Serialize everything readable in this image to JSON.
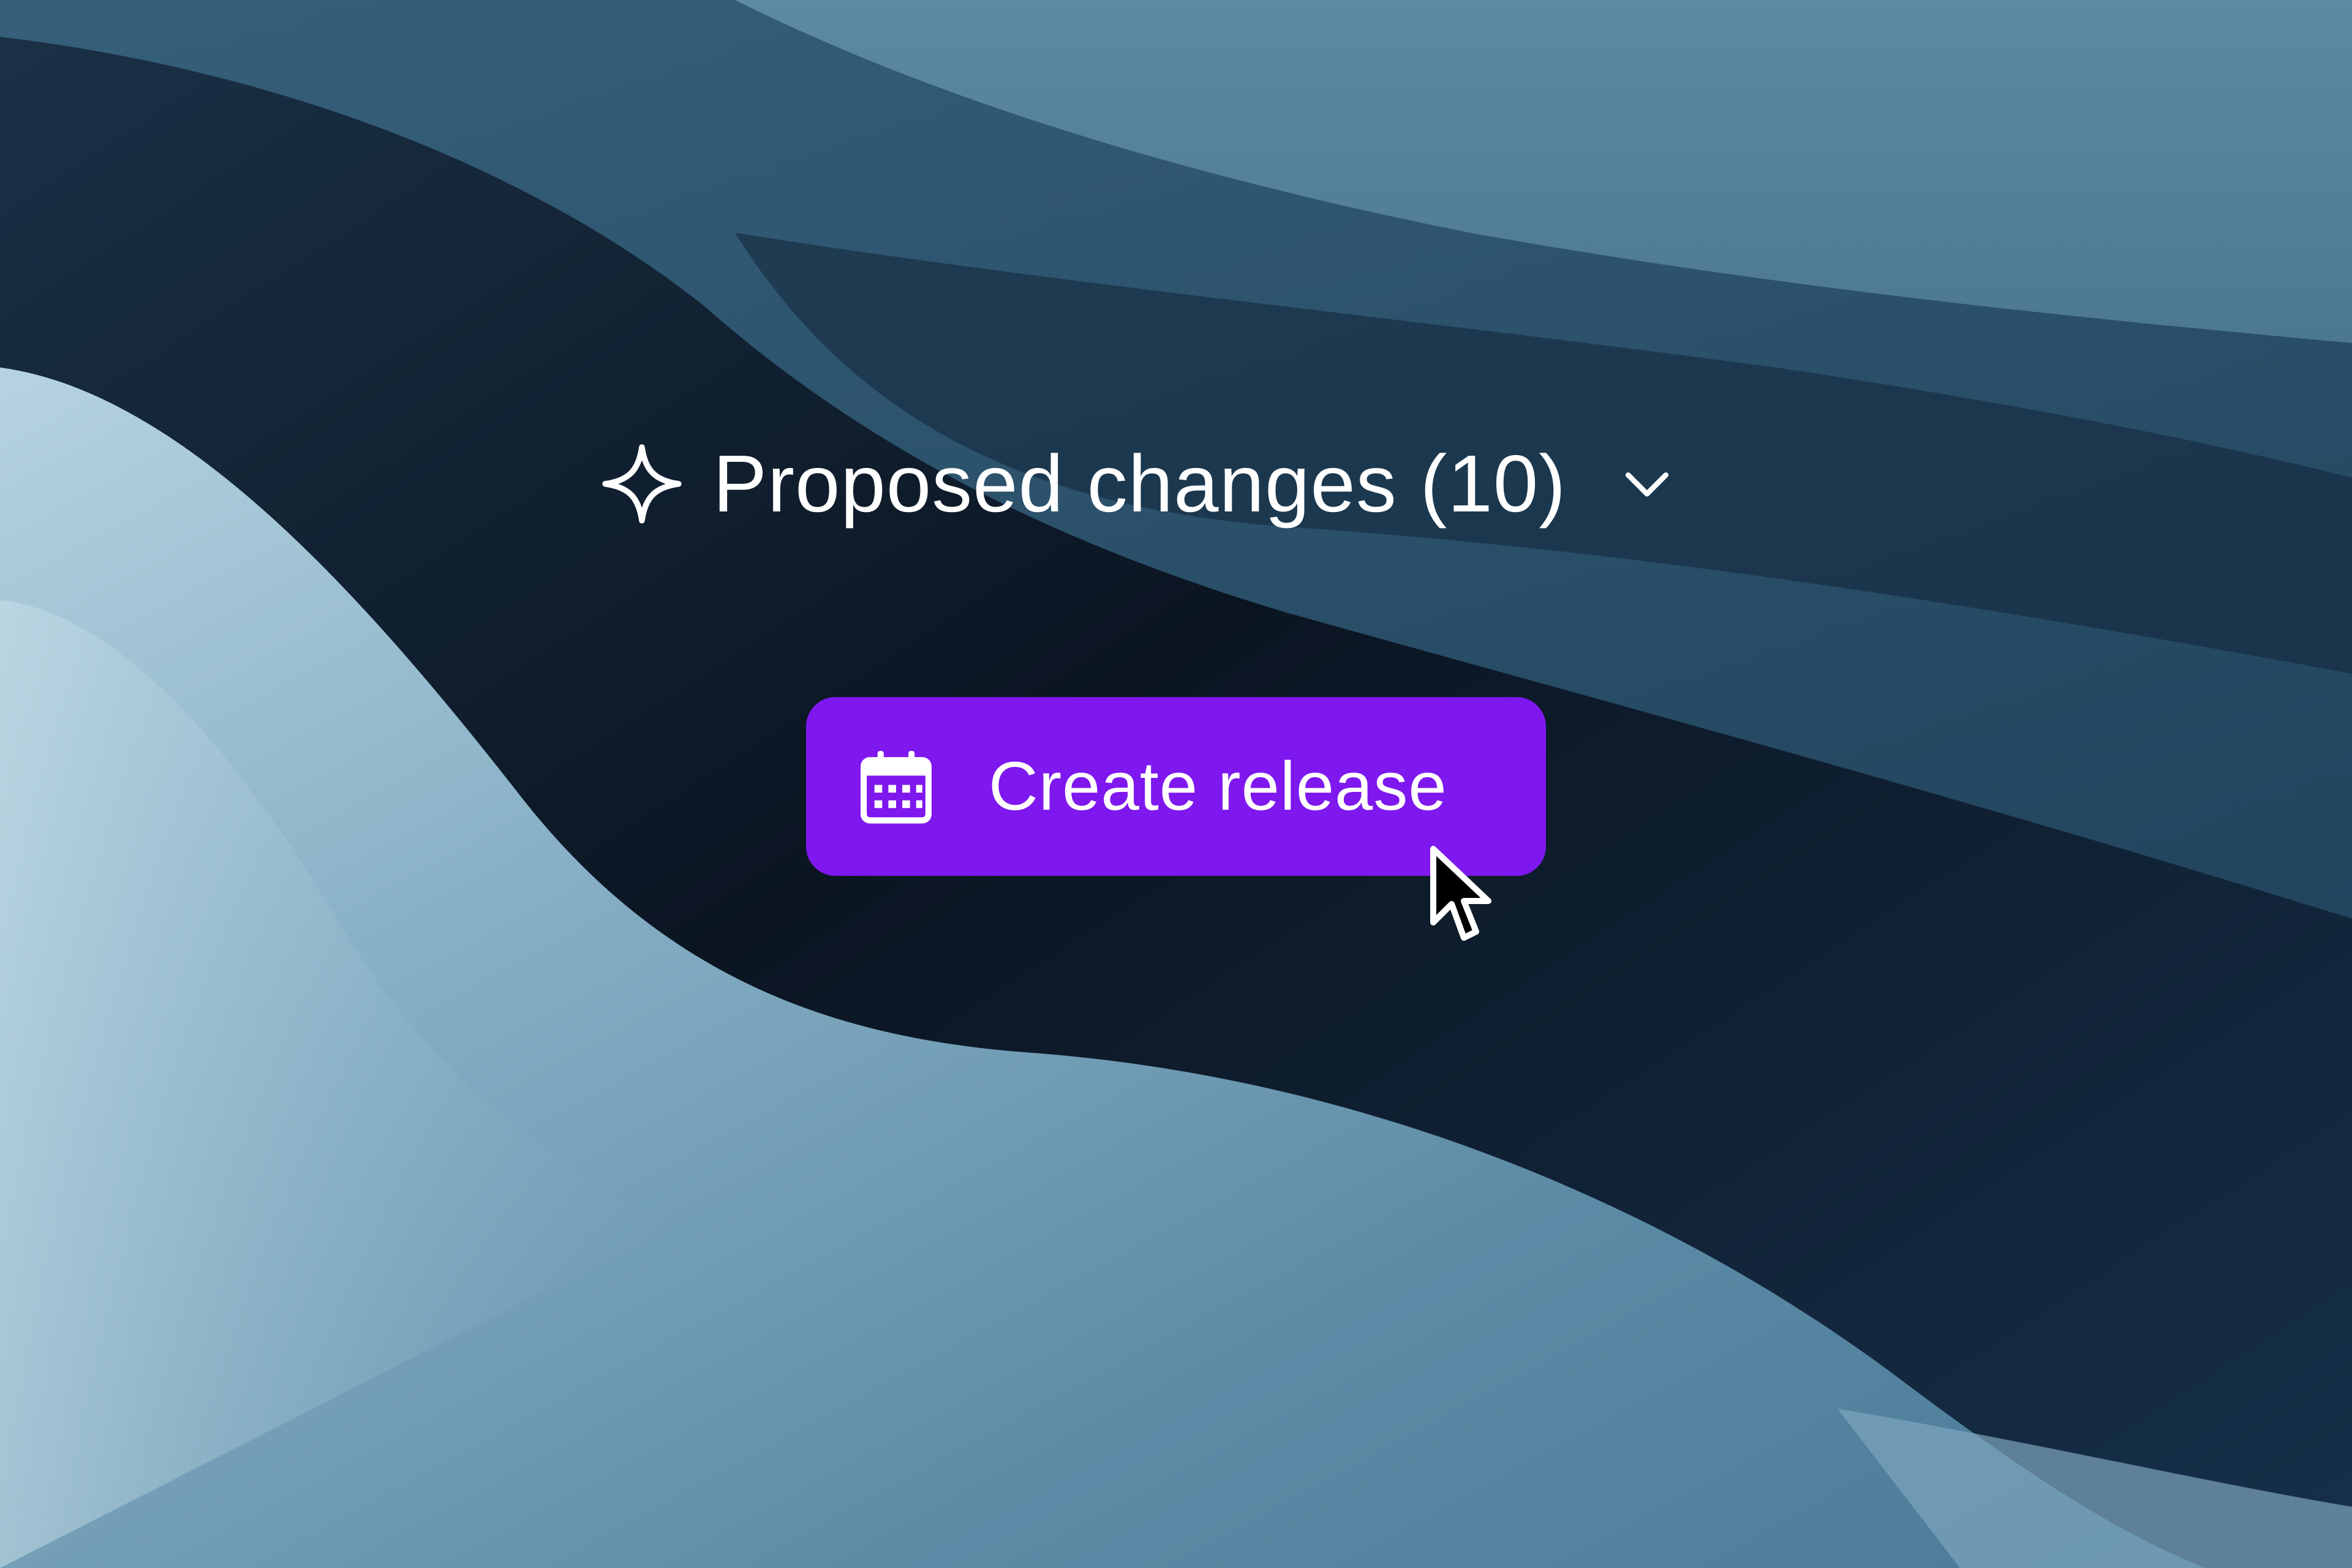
{
  "proposed_changes": {
    "label": "Proposed changes (10)",
    "leading_icon": "sparkle-icon",
    "trailing_icon": "chevron-down-icon"
  },
  "create_release": {
    "label": "Create release",
    "icon": "calendar-icon",
    "color": "#7e18ee"
  },
  "cursor": {
    "icon": "mouse-pointer-icon"
  }
}
